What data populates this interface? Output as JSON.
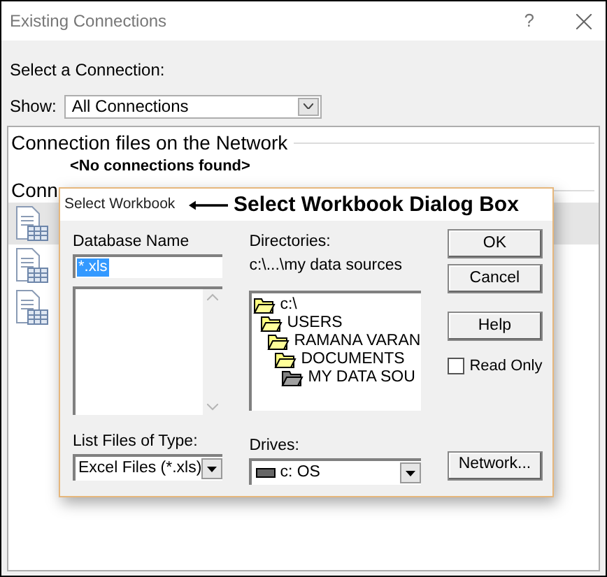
{
  "window": {
    "title": "Existing Connections",
    "help": "?"
  },
  "select_label": "Select a Connection:",
  "show": {
    "label": "Show:",
    "value": "All Connections"
  },
  "connections": {
    "sections": [
      {
        "heading": "Connection files on the Network",
        "items": [
          "<No connections found>"
        ]
      },
      {
        "heading": "Conn"
      }
    ],
    "file_rows": [
      {
        "selected": true
      },
      {
        "selected": false
      },
      {
        "selected": false
      }
    ]
  },
  "dialog": {
    "title": "Select Workbook",
    "annotation": "Select Workbook Dialog Box",
    "database_name": {
      "label": "Database Name",
      "value": "*.xls"
    },
    "list_files_type": {
      "label": "List Files of Type:",
      "value": "Excel Files (*.xls)"
    },
    "directories": {
      "label": "Directories:",
      "path": "c:\\...\\my data sources",
      "tree": [
        {
          "name": "c:\\",
          "selected": false,
          "children": [
            {
              "name": "USERS",
              "selected": false,
              "children": [
                {
                  "name": "RAMANA VARAN",
                  "selected": false,
                  "children": [
                    {
                      "name": "DOCUMENTS",
                      "selected": false,
                      "children": [
                        {
                          "name": "MY DATA SOU",
                          "selected": true
                        }
                      ]
                    }
                  ]
                }
              ]
            }
          ]
        }
      ]
    },
    "drives": {
      "label": "Drives:",
      "value": "c: OS"
    },
    "buttons": [
      {
        "label": "OK"
      },
      {
        "label": "Cancel"
      },
      {
        "label": "Help"
      }
    ],
    "read_only": {
      "label": "Read Only",
      "checked": false
    },
    "network_button": "Network..."
  }
}
